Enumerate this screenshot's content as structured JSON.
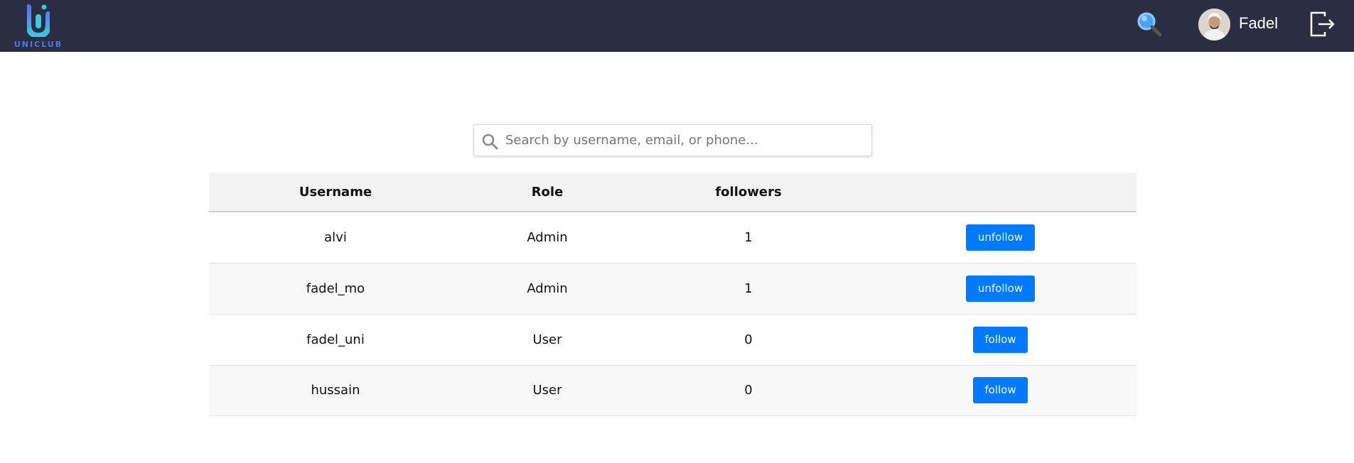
{
  "brand": {
    "name": "UNICLUB"
  },
  "navbar": {
    "search_icon": "search-icon",
    "user_name": "Fadel",
    "logout_icon": "logout-icon"
  },
  "search": {
    "placeholder": "Search by username, email, or phone...",
    "value": ""
  },
  "table": {
    "headers": [
      "Username",
      "Role",
      "followers",
      ""
    ],
    "rows": [
      {
        "username": "alvi",
        "role": "Admin",
        "followers": "1",
        "action": "unfollow"
      },
      {
        "username": "fadel_mo",
        "role": "Admin",
        "followers": "1",
        "action": "unfollow"
      },
      {
        "username": "fadel_uni",
        "role": "User",
        "followers": "0",
        "action": "follow"
      },
      {
        "username": "hussain",
        "role": "User",
        "followers": "0",
        "action": "follow"
      }
    ]
  },
  "colors": {
    "navbar": "#2b2d42",
    "button": "#007bff",
    "logo": "#3ec6e0"
  }
}
